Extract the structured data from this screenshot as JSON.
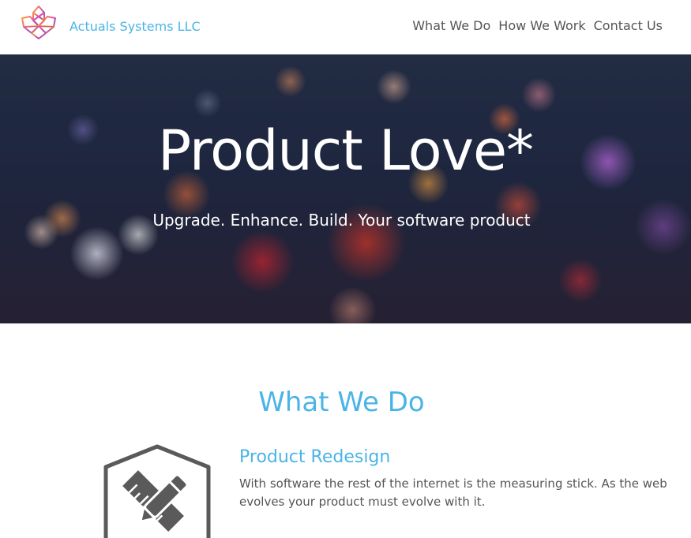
{
  "header": {
    "brand": "Actuals Systems LLC",
    "logo_icon": "maple-leaf-icon",
    "nav": [
      {
        "label": "What We Do"
      },
      {
        "label": "How We Work"
      },
      {
        "label": "Contact Us"
      }
    ]
  },
  "hero": {
    "title": "Product Love*",
    "subtitle": "Upgrade. Enhance. Build. Your software product"
  },
  "what_we_do": {
    "heading": "What We Do",
    "services": [
      {
        "icon": "pencil-ruler-icon",
        "title": "Product Redesign",
        "description": "With software the rest of the internet is the measuring stick. As the web evolves your product must evolve with it."
      }
    ]
  },
  "colors": {
    "accent": "#4bb4e6",
    "nav_text": "#555555",
    "body_text": "#555555",
    "icon_gray": "#5a5a5a"
  }
}
